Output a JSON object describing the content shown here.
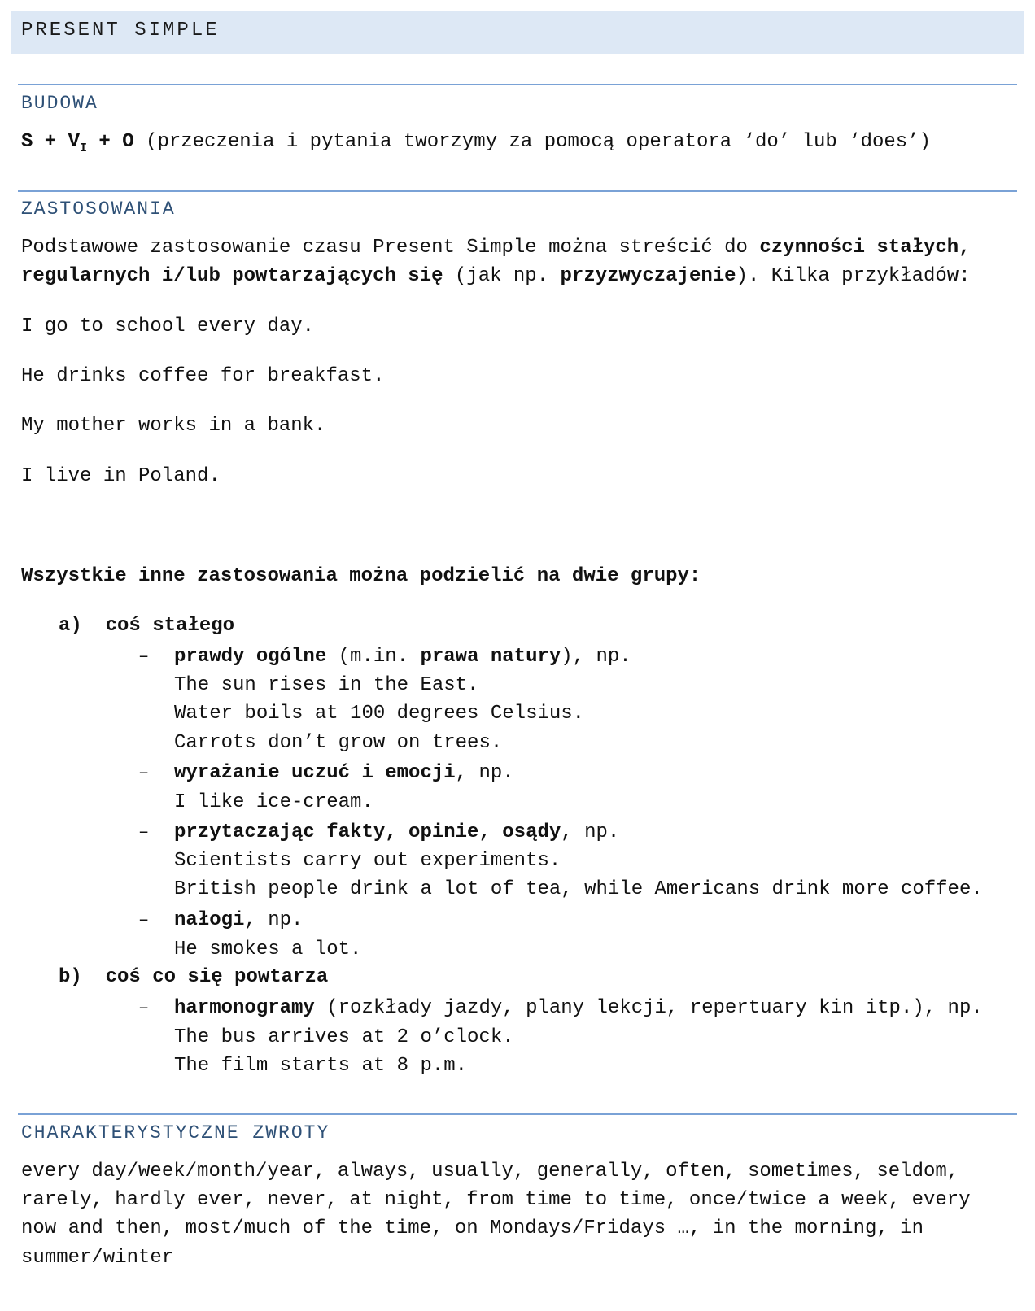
{
  "title": "PRESENT SIMPLE",
  "budowa": {
    "heading": "BUDOWA",
    "formula_s": "S + V",
    "formula_sub": "I",
    "formula_end": " + O",
    "formula_note": " (przeczenia i pytania tworzymy za pomocą operatora ‘do’ lub ‘does’)"
  },
  "zastosowania": {
    "heading": "ZASTOSOWANIA",
    "intro_1_a": "Podstawowe zastosowanie czasu Present Simple można streścić do ",
    "intro_1_b": "czynności stałych,",
    "intro_2_a": "regularnych i/lub powtarzających się",
    "intro_2_b": " (jak np. ",
    "intro_2_c": "przyzwyczajenie",
    "intro_2_d": "). Kilka przykładów:",
    "examples": [
      "I go to school every day.",
      "He drinks coffee for breakfast.",
      "My mother works in a bank.",
      "I live in Poland."
    ],
    "groups_heading": "Wszystkie inne zastosowania można podzielić na dwie grupy:",
    "group_a": {
      "label": "a)  coś stałego",
      "items": [
        {
          "title_a": "prawdy ogólne",
          "title_b": " (m.in. ",
          "title_c": "prawa natury",
          "title_d": "), np.",
          "examples": [
            "The sun rises in the East.",
            "Water boils at 100 degrees Celsius.",
            "Carrots don’t grow on trees."
          ]
        },
        {
          "title_a": "wyrażanie uczuć i emocji",
          "title_b": ", np.",
          "examples": [
            "I like ice-cream."
          ]
        },
        {
          "title_a": "przytaczając fakty, opinie, osądy",
          "title_b": ", np.",
          "examples": [
            "Scientists carry out experiments.",
            "British people drink a lot of tea, while Americans drink more coffee."
          ]
        },
        {
          "title_a": "nałogi",
          "title_b": ", np.",
          "examples": [
            "He smokes a lot."
          ]
        }
      ]
    },
    "group_b": {
      "label": "b)  coś co się powtarza",
      "items": [
        {
          "title_a": "harmonogramy",
          "title_b": " (rozkłady jazdy, plany lekcji, repertuary kin itp.), np.",
          "examples": [
            "The bus arrives at 2 o’clock.",
            "The film starts at 8 p.m."
          ]
        }
      ]
    },
    "dash": "–"
  },
  "zwroty": {
    "heading": "CHARAKTERYSTYCZNE ZWROTY",
    "lines": [
      "every day/week/month/year, always, usually, generally, often, sometimes, seldom,",
      "rarely, hardly ever, never, at night, from time to time, once/twice a week, every",
      "now and then, most/much of the time, on Mondays/Fridays …, in the morning, in",
      "summer/winter"
    ]
  }
}
